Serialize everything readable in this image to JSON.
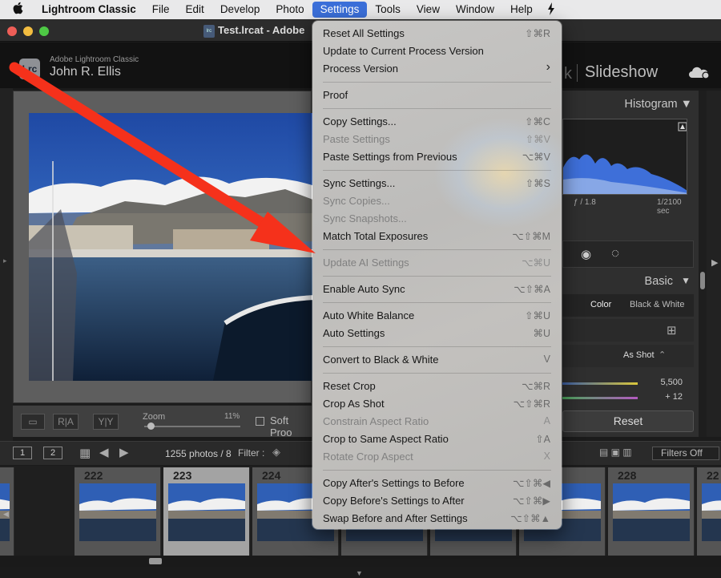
{
  "menubar": {
    "apple_icon": "apple-logo",
    "app_name": "Lightroom Classic",
    "items": [
      "File",
      "Edit",
      "Develop",
      "Photo",
      "Settings",
      "Tools",
      "View",
      "Window",
      "Help"
    ],
    "active": "Settings",
    "extra_icon": "lightning-icon"
  },
  "window": {
    "title": "Test.lrcat - Adobe",
    "doc_icon_text": "lrc"
  },
  "identity": {
    "logo": "Lrc",
    "product": "Adobe Lightroom Classic",
    "user": "John R. Ellis",
    "module_sep": "k",
    "module": "Slideshow"
  },
  "toolbar": {
    "zoom_label": "Zoom",
    "zoom_value": "11%",
    "zoom_fraction": 0.11,
    "ra_label": "R|A",
    "yy_label": "Y|Y",
    "soft_proof": "Soft Proo"
  },
  "right_panel": {
    "histogram_title": "Histogram",
    "aperture": "ƒ / 1.8",
    "shutter": "1/2100 sec",
    "basic_title": "Basic",
    "color_tab": "Color",
    "bw_tab": "Black & White",
    "wb_value": "As Shot",
    "temp_value": "5,500",
    "tint_value": "+ 12",
    "reset_label": "Reset"
  },
  "filmstrip_bar": {
    "page1": "1",
    "page2": "2",
    "photo_count": "1255 photos / 8",
    "filter_label": "Filter :",
    "filters_off": "Filters Off"
  },
  "filmstrip": {
    "cells": [
      {
        "num": "1"
      },
      {
        "num": "222"
      },
      {
        "num": "223"
      },
      {
        "num": "224"
      },
      {
        "num": ""
      },
      {
        "num": ""
      },
      {
        "num": ""
      },
      {
        "num": "228"
      },
      {
        "num": "22"
      }
    ]
  },
  "settings_menu": {
    "items": [
      {
        "label": "Reset All Settings",
        "shortcut": "⇧⌘R",
        "enabled": true
      },
      {
        "label": "Update to Current Process Version",
        "shortcut": "",
        "enabled": true
      },
      {
        "label": "Process Version",
        "shortcut": "›",
        "enabled": true
      },
      {
        "label": "Proof",
        "shortcut": "",
        "enabled": true
      },
      {
        "label": "Copy Settings...",
        "shortcut": "⇧⌘C",
        "enabled": true
      },
      {
        "label": "Paste Settings",
        "shortcut": "⇧⌘V",
        "enabled": false
      },
      {
        "label": "Paste Settings from Previous",
        "shortcut": "⌥⌘V",
        "enabled": true
      },
      {
        "label": "Sync Settings...",
        "shortcut": "⇧⌘S",
        "enabled": true
      },
      {
        "label": "Sync Copies...",
        "shortcut": "",
        "enabled": false
      },
      {
        "label": "Sync Snapshots...",
        "shortcut": "",
        "enabled": false
      },
      {
        "label": "Match Total Exposures",
        "shortcut": "⌥⇧⌘M",
        "enabled": true
      },
      {
        "label": "Update AI Settings",
        "shortcut": "⌥⌘U",
        "enabled": false
      },
      {
        "label": "Enable Auto Sync",
        "shortcut": "⌥⇧⌘A",
        "enabled": true
      },
      {
        "label": "Auto White Balance",
        "shortcut": "⇧⌘U",
        "enabled": true
      },
      {
        "label": "Auto Settings",
        "shortcut": "⌘U",
        "enabled": true
      },
      {
        "label": "Convert to Black & White",
        "shortcut": "V",
        "enabled": true
      },
      {
        "label": "Reset Crop",
        "shortcut": "⌥⌘R",
        "enabled": true
      },
      {
        "label": "Crop As Shot",
        "shortcut": "⌥⇧⌘R",
        "enabled": true
      },
      {
        "label": "Constrain Aspect Ratio",
        "shortcut": "A",
        "enabled": false
      },
      {
        "label": "Crop to Same Aspect Ratio",
        "shortcut": "⇧A",
        "enabled": true
      },
      {
        "label": "Rotate Crop Aspect",
        "shortcut": "X",
        "enabled": false
      },
      {
        "label": "Copy After's Settings to Before",
        "shortcut": "⌥⇧⌘◀",
        "enabled": true
      },
      {
        "label": "Copy Before's Settings to After",
        "shortcut": "⌥⇧⌘▶",
        "enabled": true
      },
      {
        "label": "Swap Before and After Settings",
        "shortcut": "⌥⇧⌘▲",
        "enabled": true
      }
    ]
  },
  "annotation": {
    "arrow_color": "#f5311b"
  },
  "colors": {
    "menu_active": "#3b6fd9",
    "accent_red": "#f5311b"
  }
}
